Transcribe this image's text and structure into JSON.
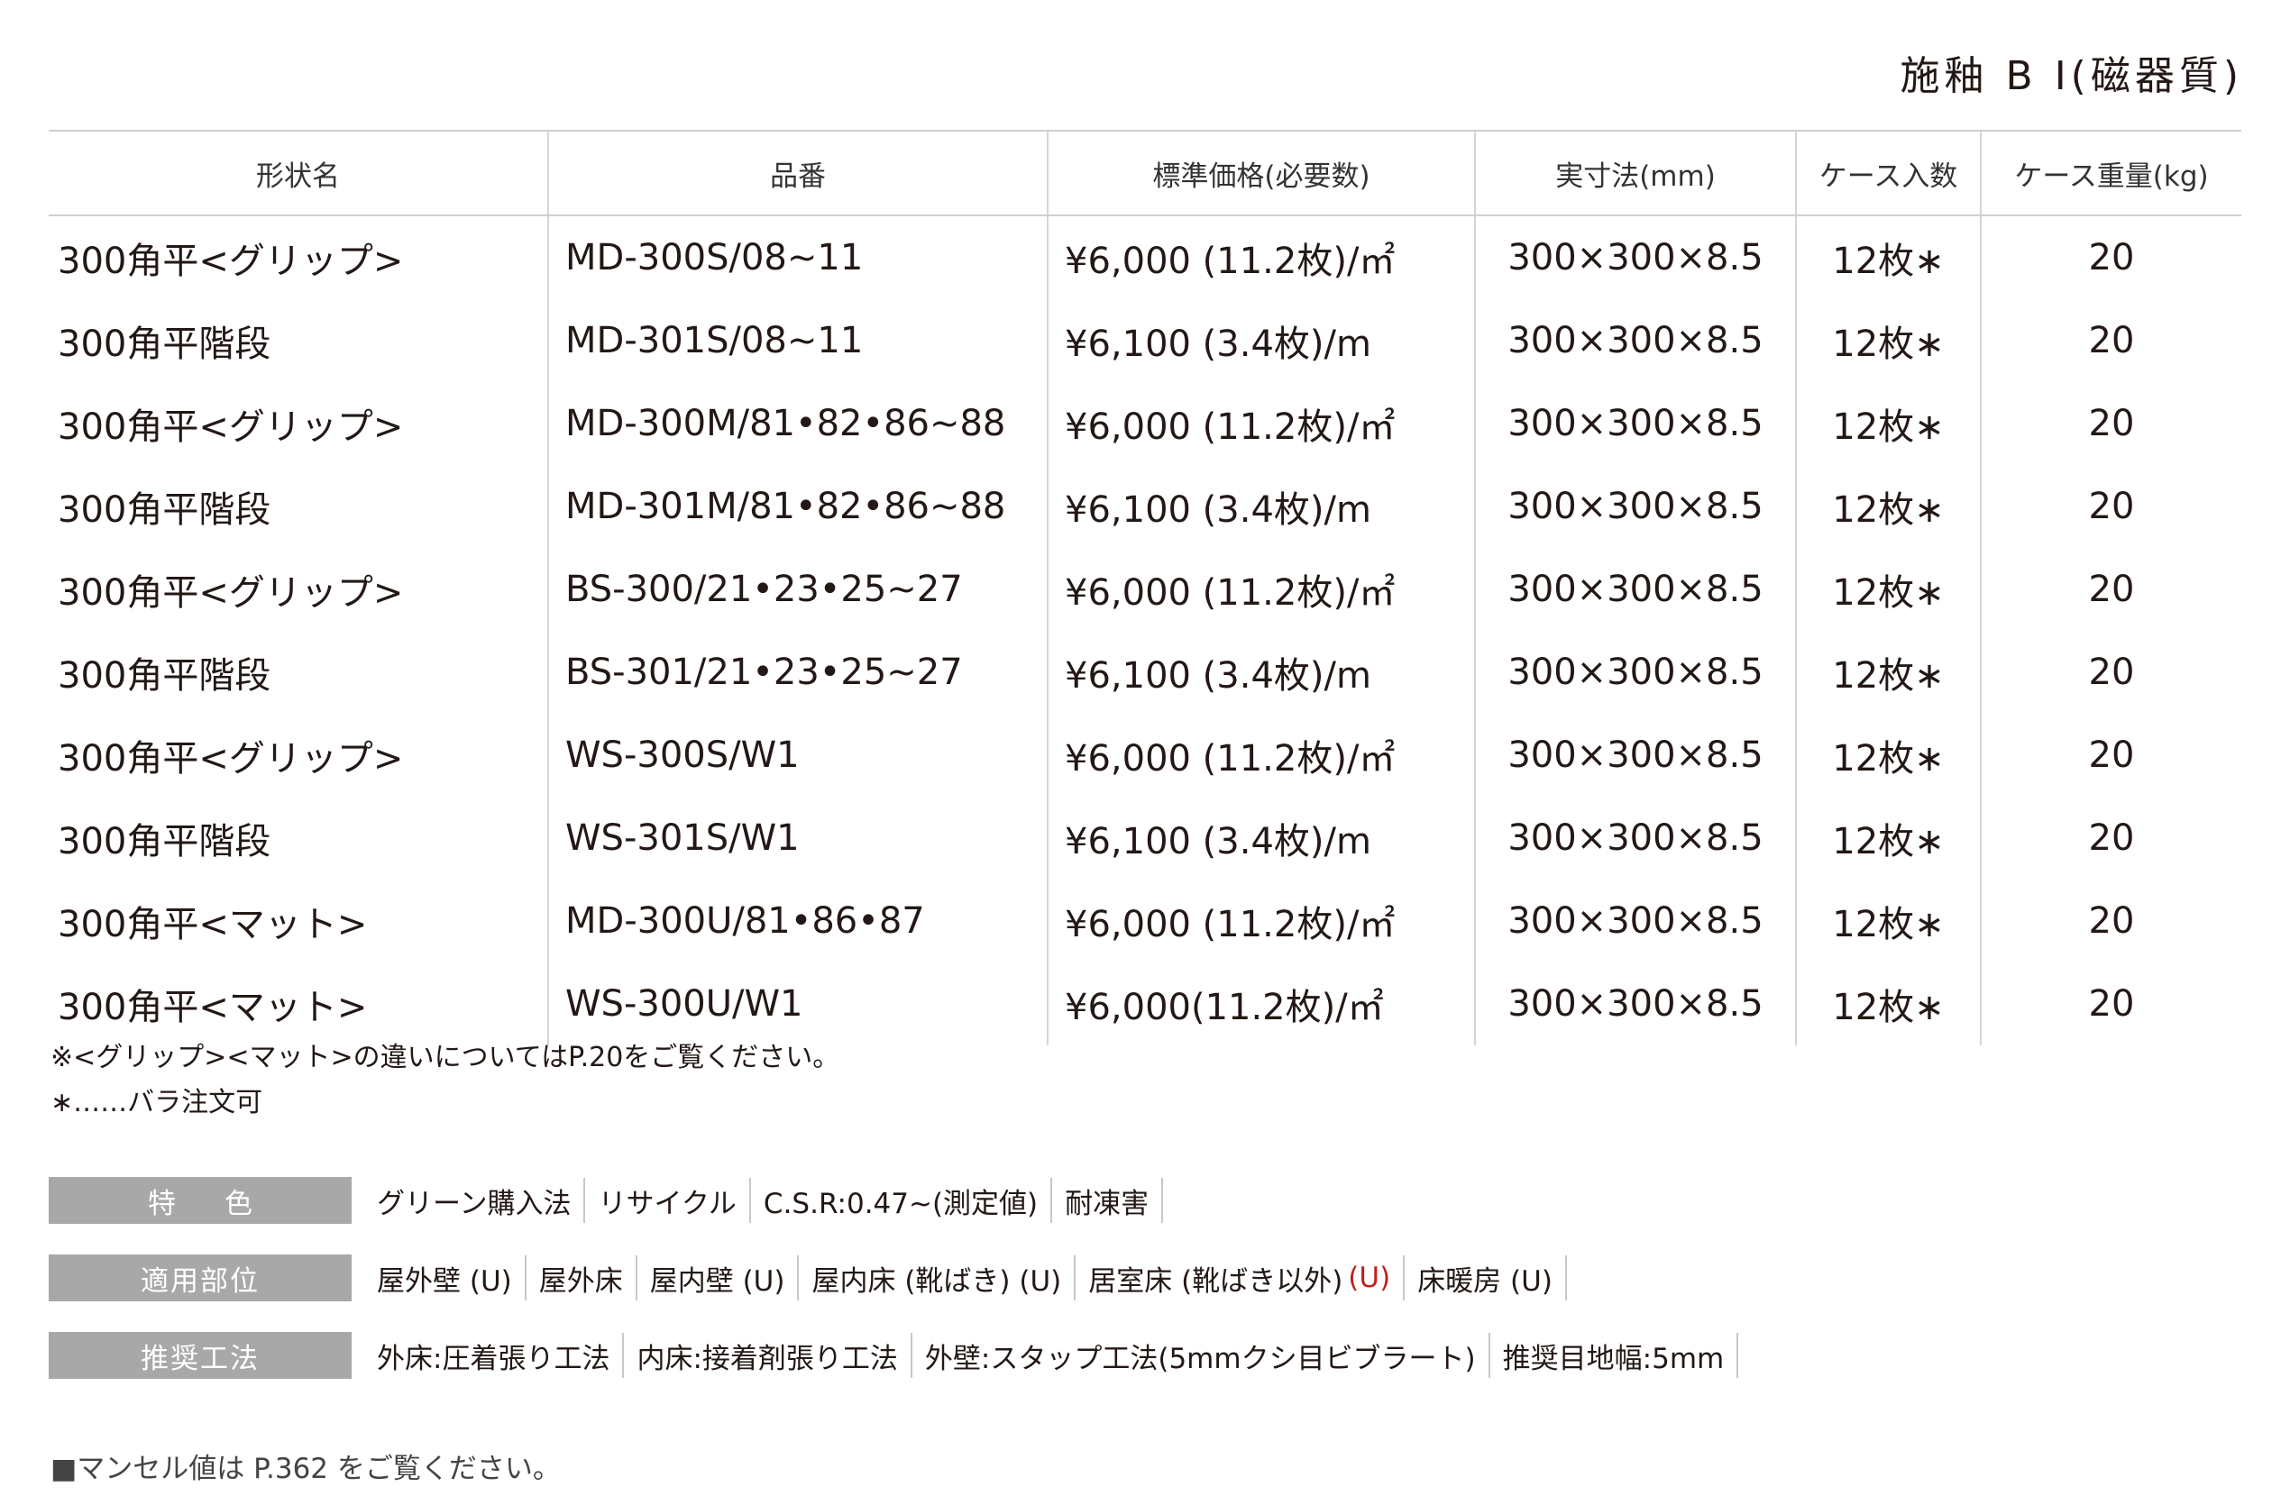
{
  "header": {
    "title": "施釉 B I(磁器質)"
  },
  "table": {
    "columns": [
      "形状名",
      "品番",
      "標準価格(必要数)",
      "実寸法(mm)",
      "ケース入数",
      "ケース重量(kg)"
    ],
    "rows": [
      {
        "name": "300角平<グリップ>",
        "code": "MD-300S/08~11",
        "price": "¥6,000 (11.2枚)/㎡",
        "size": "300×300×8.5",
        "qty": "12枚∗",
        "weight": "20"
      },
      {
        "name": "300角平階段",
        "code": "MD-301S/08~11",
        "price": "¥6,100 (3.4枚)/m",
        "size": "300×300×8.5",
        "qty": "12枚∗",
        "weight": "20"
      },
      {
        "name": "300角平<グリップ>",
        "code": "MD-300M/81•82•86~88",
        "price": "¥6,000 (11.2枚)/㎡",
        "size": "300×300×8.5",
        "qty": "12枚∗",
        "weight": "20"
      },
      {
        "name": "300角平階段",
        "code": "MD-301M/81•82•86~88",
        "price": "¥6,100 (3.4枚)/m",
        "size": "300×300×8.5",
        "qty": "12枚∗",
        "weight": "20"
      },
      {
        "name": "300角平<グリップ>",
        "code": "BS-300/21•23•25~27",
        "price": "¥6,000 (11.2枚)/㎡",
        "size": "300×300×8.5",
        "qty": "12枚∗",
        "weight": "20"
      },
      {
        "name": "300角平階段",
        "code": "BS-301/21•23•25~27",
        "price": "¥6,100 (3.4枚)/m",
        "size": "300×300×8.5",
        "qty": "12枚∗",
        "weight": "20"
      },
      {
        "name": "300角平<グリップ>",
        "code": "WS-300S/W1",
        "price": "¥6,000 (11.2枚)/㎡",
        "size": "300×300×8.5",
        "qty": "12枚∗",
        "weight": "20"
      },
      {
        "name": "300角平階段",
        "code": "WS-301S/W1",
        "price": "¥6,100 (3.4枚)/m",
        "size": "300×300×8.5",
        "qty": "12枚∗",
        "weight": "20"
      },
      {
        "name": "300角平<マット>",
        "code": "MD-300U/81•86•87",
        "price": "¥6,000 (11.2枚)/㎡",
        "size": "300×300×8.5",
        "qty": "12枚∗",
        "weight": "20"
      },
      {
        "name": "300角平<マット>",
        "code": "WS-300U/W1",
        "price": "¥6,000(11.2枚)/㎡",
        "size": "300×300×8.5",
        "qty": "12枚∗",
        "weight": "20"
      }
    ]
  },
  "notes": {
    "note1": "※<グリップ><マット>の違いについてはP.20をご覧ください。",
    "note2": "∗……バラ注文可"
  },
  "features": {
    "label": "特色",
    "items": [
      "グリーン購入法",
      "リサイクル",
      "C.S.R:0.47~(測定値)",
      "耐凍害"
    ]
  },
  "applications": {
    "label": "適用部位",
    "items": [
      "屋外壁 (U)",
      "屋外床",
      "屋内壁 (U)",
      "屋内床 (靴ばき) (U)",
      "居室床 (靴ばき以外)",
      "床暖房 (U)"
    ],
    "red_mark": "(U)",
    "red_color": "#c0201d"
  },
  "methods": {
    "label": "推奨工法",
    "items": [
      "外床:圧着張り工法",
      "内床:接着剤張り工法",
      "外壁:スタップ工法(5mmクシ目ビブラート)",
      "推奨目地幅:5mm"
    ]
  },
  "footer": {
    "munsell_note": "■マンセル値は P.362 をご覧ください。"
  },
  "colors": {
    "label_bg": "#a8a8a8",
    "text": "#231815",
    "rule": "#cfcfcf"
  }
}
